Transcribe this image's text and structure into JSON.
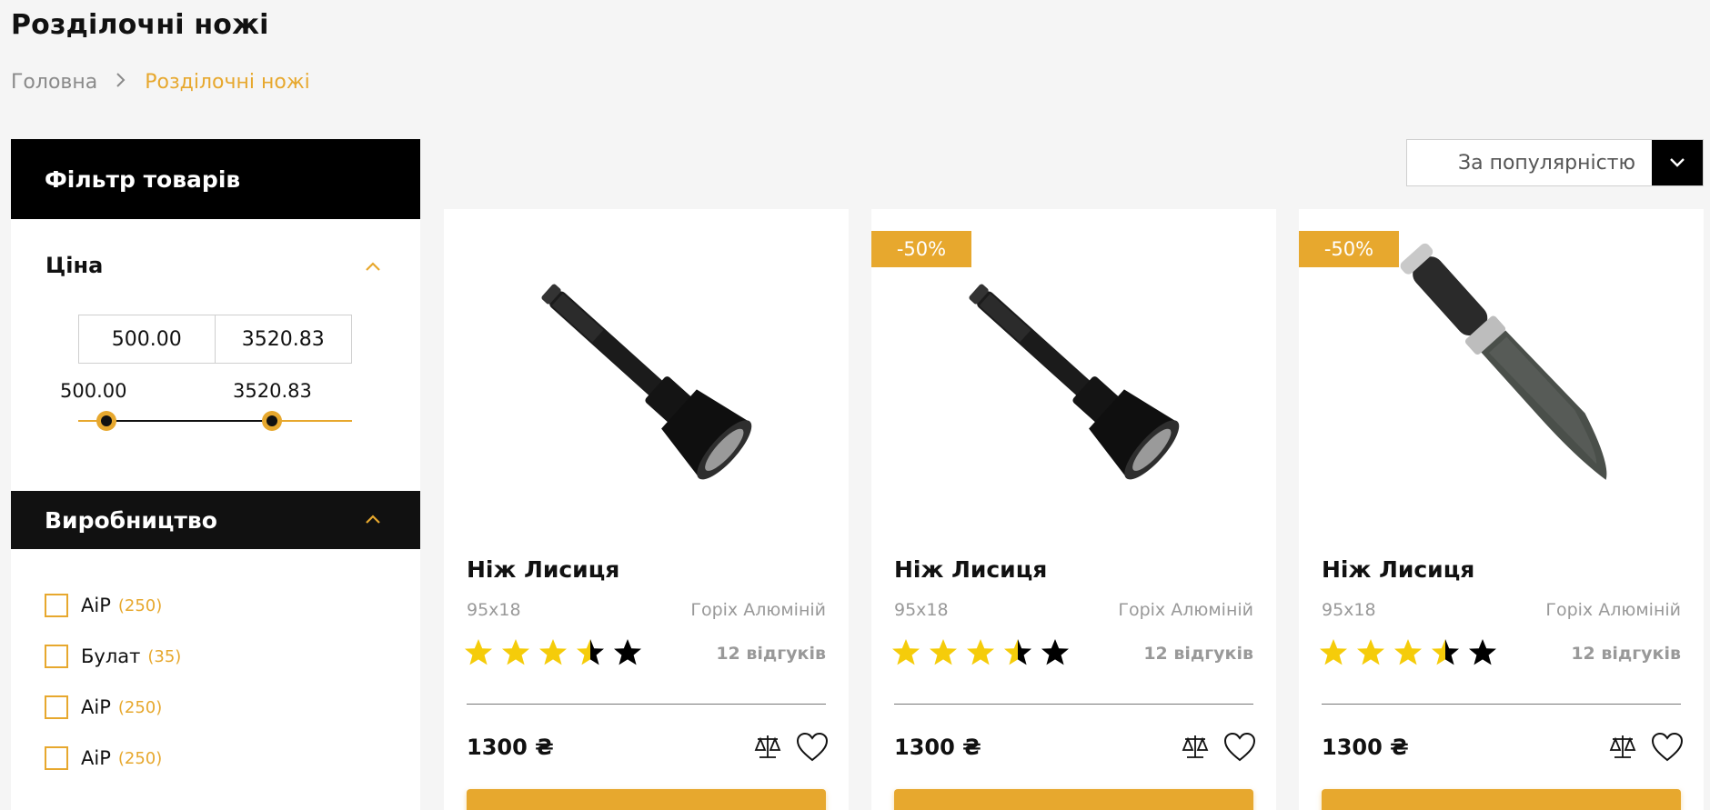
{
  "page": {
    "title": "Розділочні ножі",
    "breadcrumb": {
      "home": "Головна",
      "current": "Розділочні ножі"
    }
  },
  "filter": {
    "title": "Фільтр товарів",
    "price": {
      "title": "Ціна",
      "min_input": "500.00",
      "max_input": "3520.83",
      "min_label": "500.00",
      "max_label": "3520.83"
    },
    "manufacturer": {
      "title": "Виробництво",
      "items": [
        {
          "name": "AiP",
          "count": "(250)"
        },
        {
          "name": "Булат",
          "count": "(35)"
        },
        {
          "name": "AiP",
          "count": "(250)"
        },
        {
          "name": "AiP",
          "count": "(250)"
        }
      ]
    }
  },
  "sort": {
    "label": "За популярністю",
    "icon": "chevron-down-icon"
  },
  "products": [
    {
      "badge": "",
      "name": "Ніж Лисиця",
      "size": "95x18",
      "material": "Горіх Алюміній",
      "rating": 3.5,
      "reviews": "12 відгуків",
      "price": "1300 ₴",
      "image": "flashlight"
    },
    {
      "badge": "-50%",
      "name": "Ніж Лисиця",
      "size": "95x18",
      "material": "Горіх Алюміній",
      "rating": 3.5,
      "reviews": "12 відгуків",
      "price": "1300 ₴",
      "image": "flashlight"
    },
    {
      "badge": "-50%",
      "name": "Ніж Лисиця",
      "size": "95x18",
      "material": "Горіх Алюміній",
      "rating": 3.5,
      "reviews": "12 відгуків",
      "price": "1300 ₴",
      "image": "knife"
    }
  ],
  "colors": {
    "accent": "#e7a82e",
    "star": "#f5cc0a",
    "dark": "#000000"
  }
}
